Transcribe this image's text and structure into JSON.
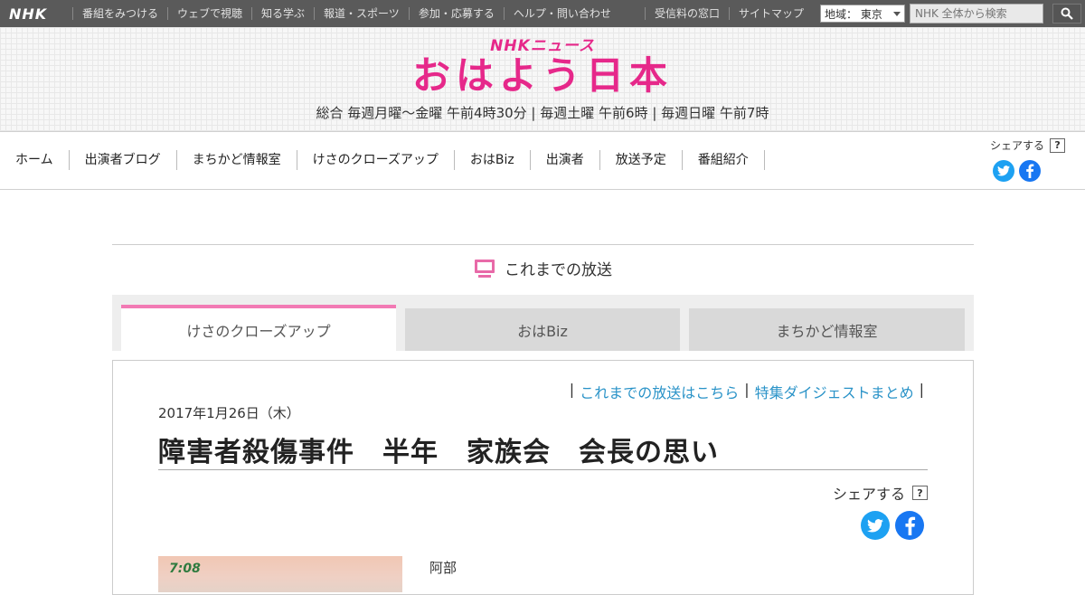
{
  "global_bar": {
    "logo": "NHK",
    "nav": [
      "番組をみつける",
      "ウェブで視聴",
      "知る学ぶ",
      "報道・スポーツ",
      "参加・応募する",
      "ヘルプ・問い合わせ"
    ],
    "nav_right": [
      "受信料の窓口",
      "サイトマップ"
    ],
    "region_label": "地域： 東京",
    "search_placeholder": "NHK 全体から検索"
  },
  "header": {
    "kicker": "NHKニュース",
    "title": "おはよう日本",
    "schedule": "総合 毎週月曜～金曜 午前4時30分 | 毎週土曜 午前6時 | 毎週日曜 午前7時"
  },
  "program_nav": {
    "items": [
      "ホーム",
      "出演者ブログ",
      "まちかど情報室",
      "けさのクローズアップ",
      "おはBiz",
      "出演者",
      "放送予定",
      "番組紹介"
    ],
    "share_label": "シェアする",
    "help_mark": "?"
  },
  "section": {
    "title": "これまでの放送",
    "tabs": [
      "けさのクローズアップ",
      "おはBiz",
      "まちかど情報室"
    ],
    "active_tab": "けさのクローズアップ"
  },
  "article": {
    "links": [
      "これまでの放送はこちら",
      "特集ダイジェストまとめ"
    ],
    "separator": "|",
    "date": "2017年1月26日（木）",
    "headline": "障害者殺傷事件　半年　家族会　会長の思い",
    "share_label": "シェアする",
    "help_mark": "?",
    "thumb_time": "7:08",
    "speaker": "阿部"
  },
  "colors": {
    "accent_pink": "#e6288a",
    "tab_active": "#f27ab4",
    "link_blue": "#2a93c8",
    "twitter": "#1da1f2",
    "facebook": "#1877f2"
  }
}
